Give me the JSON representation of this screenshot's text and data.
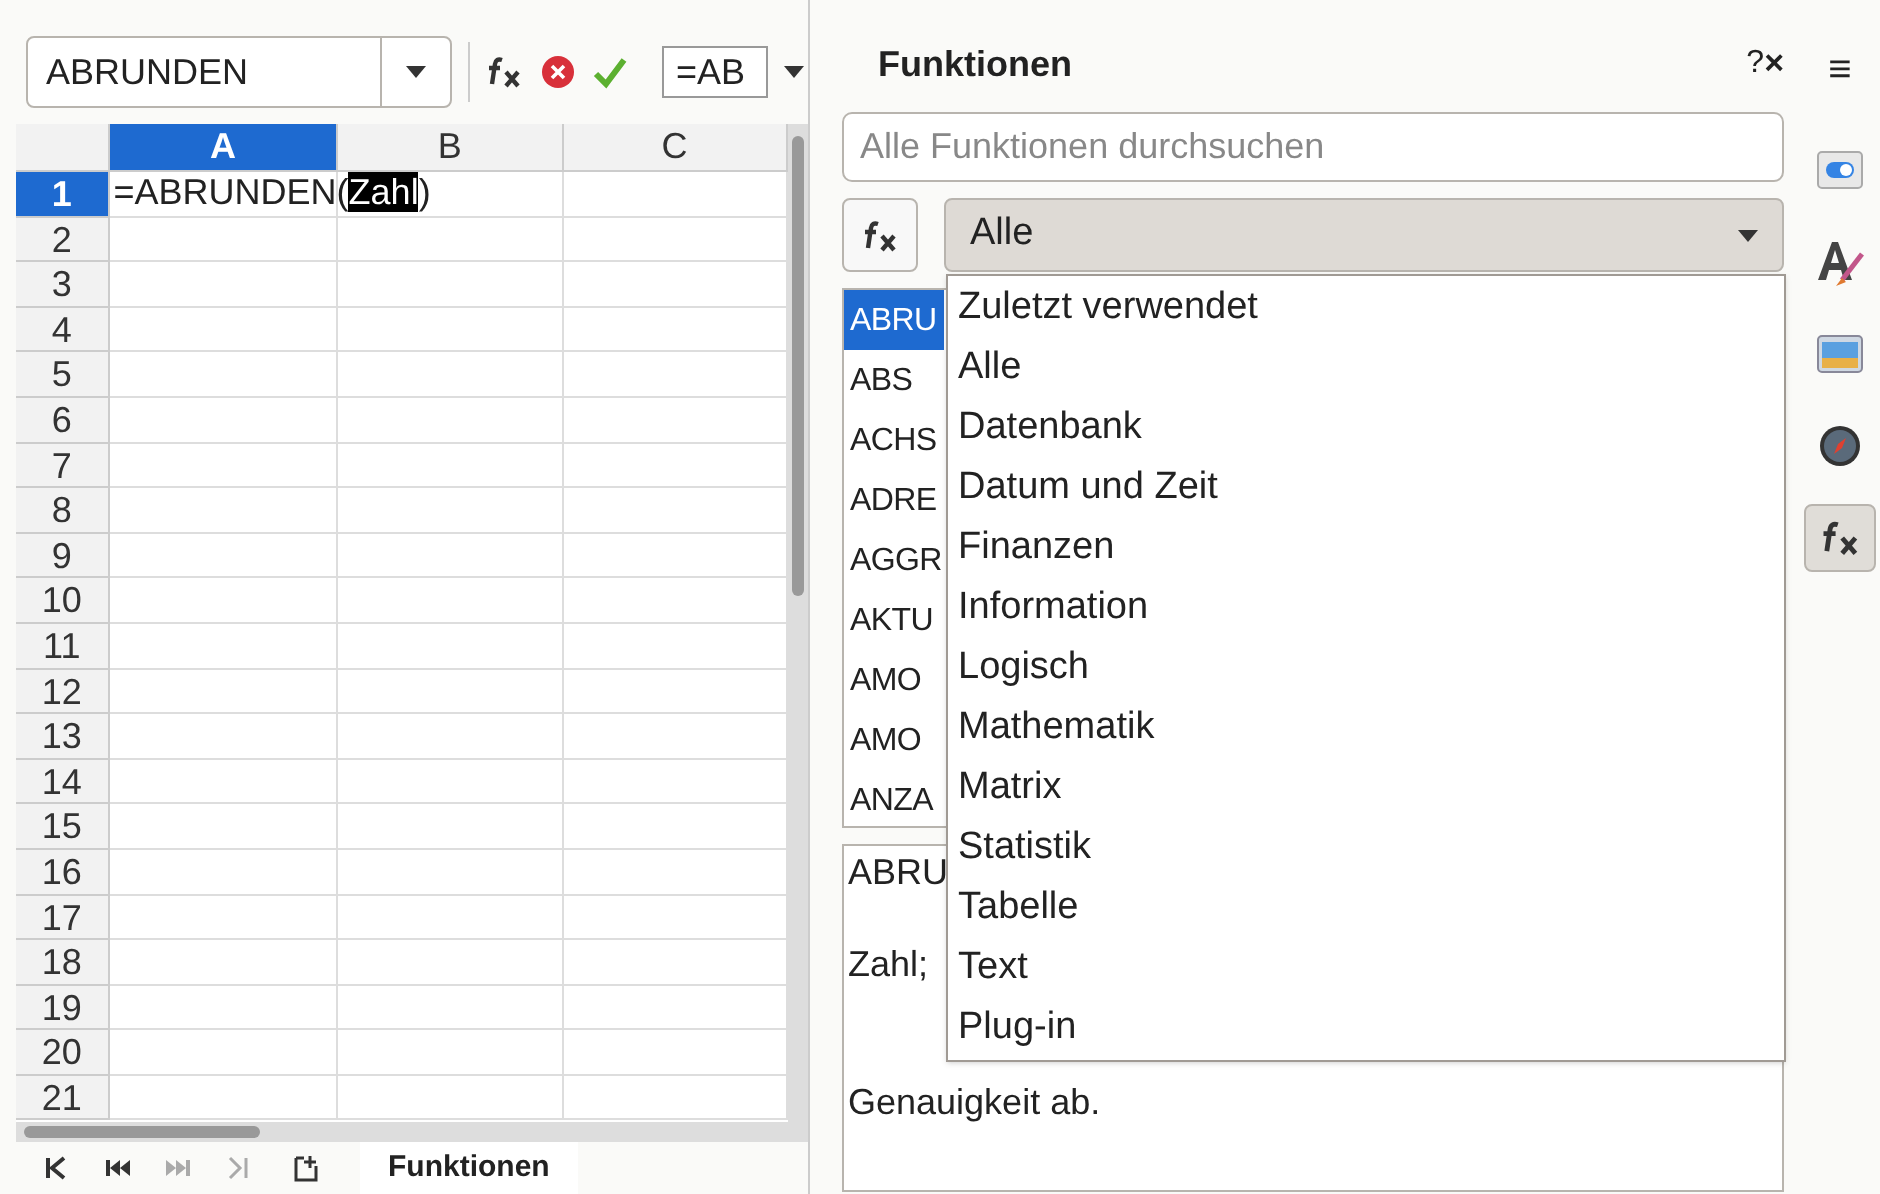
{
  "formula_bar": {
    "name_box": "ABRUNDEN",
    "input": "=AB"
  },
  "sheet": {
    "columns": [
      {
        "label": "A",
        "selected": true
      },
      {
        "label": "B",
        "selected": false
      },
      {
        "label": "C",
        "selected": false
      }
    ],
    "rows": [
      {
        "label": "1",
        "selected": true
      },
      {
        "label": "2",
        "selected": false
      },
      {
        "label": "3",
        "selected": false
      },
      {
        "label": "4",
        "selected": false
      },
      {
        "label": "5",
        "selected": false
      },
      {
        "label": "6",
        "selected": false
      },
      {
        "label": "7",
        "selected": false
      },
      {
        "label": "8",
        "selected": false
      },
      {
        "label": "9",
        "selected": false
      },
      {
        "label": "10",
        "selected": false
      },
      {
        "label": "11",
        "selected": false
      },
      {
        "label": "12",
        "selected": false
      },
      {
        "label": "13",
        "selected": false
      },
      {
        "label": "14",
        "selected": false
      },
      {
        "label": "15",
        "selected": false
      },
      {
        "label": "16",
        "selected": false
      },
      {
        "label": "17",
        "selected": false
      },
      {
        "label": "18",
        "selected": false
      },
      {
        "label": "19",
        "selected": false
      },
      {
        "label": "20",
        "selected": false
      },
      {
        "label": "21",
        "selected": false
      }
    ],
    "cell_a1": {
      "before": "=ABRUNDEN(",
      "highlight": "Zahl",
      "after": ")"
    }
  },
  "sheet_tabs": {
    "nav": [
      {
        "kind": "first",
        "disabled": false
      },
      {
        "kind": "prev",
        "disabled": false
      },
      {
        "kind": "next",
        "disabled": true
      },
      {
        "kind": "last",
        "disabled": true
      }
    ],
    "tabs": [
      {
        "label": "Funktionen",
        "selected": true
      }
    ]
  },
  "panel": {
    "title": "Funktionen",
    "help": "?",
    "close": "×",
    "search": {
      "placeholder": "Alle Funktionen durchsuchen"
    },
    "category": "Alle",
    "functions": [
      {
        "label": "ABRU",
        "selected": true
      },
      {
        "label": "ABS",
        "selected": false
      },
      {
        "label": "ACHS",
        "selected": false
      },
      {
        "label": "ADRE",
        "selected": false
      },
      {
        "label": "AGGR",
        "selected": false
      },
      {
        "label": "AKTU",
        "selected": false
      },
      {
        "label": "AMO",
        "selected": false
      },
      {
        "label": "AMO",
        "selected": false
      },
      {
        "label": "ANZA",
        "selected": false
      }
    ],
    "description": [
      "ABRU",
      "Zahl;",
      "Genauigkeit ab."
    ],
    "dropdown_options": [
      "Zuletzt verwendet",
      "Alle",
      "Datenbank",
      "Datum und Zeit",
      "Finanzen",
      "Information",
      "Logisch",
      "Mathematik",
      "Matrix",
      "Statistik",
      "Tabelle",
      "Text",
      "Plug-in"
    ]
  },
  "sidebar": {
    "menu": "≡",
    "tabs": [
      {
        "kind": "properties",
        "selected": false
      },
      {
        "kind": "styles",
        "selected": false
      },
      {
        "kind": "gallery",
        "selected": false
      },
      {
        "kind": "navigator",
        "selected": false
      },
      {
        "kind": "functions",
        "selected": true
      }
    ]
  }
}
